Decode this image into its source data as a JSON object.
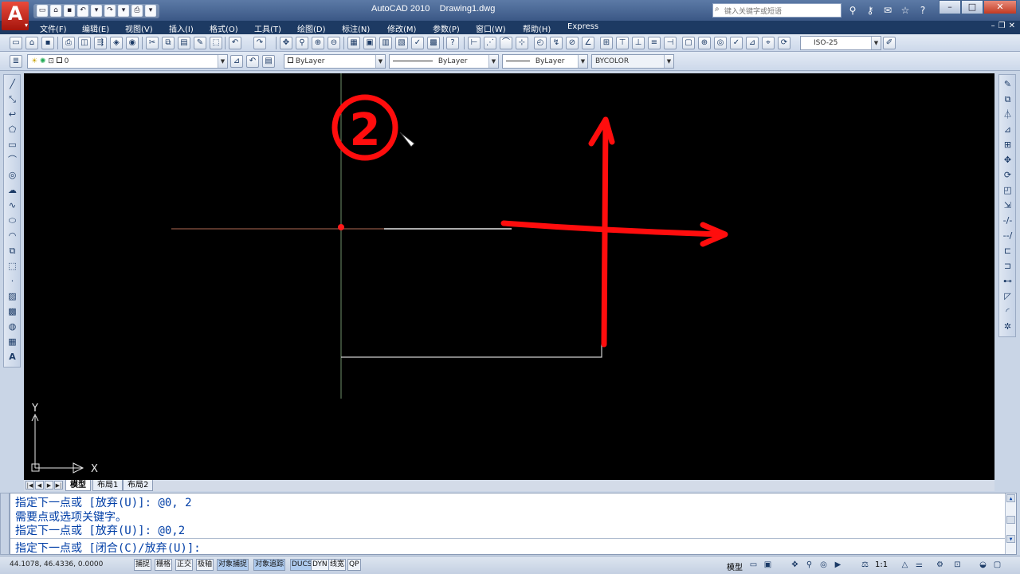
{
  "app": {
    "title": "AutoCAD 2010",
    "document": "Drawing1.dwg",
    "logo_letter": "A",
    "search_placeholder": "键入关键字或短语"
  },
  "menus": [
    "文件(F)",
    "编辑(E)",
    "视图(V)",
    "插入(I)",
    "格式(O)",
    "工具(T)",
    "绘图(D)",
    "标注(N)",
    "修改(M)",
    "参数(P)",
    "窗口(W)",
    "帮助(H)",
    "Express"
  ],
  "toolbar": {
    "dimstyle": "ISO-25",
    "layer": "0",
    "color": "ByLayer",
    "linetype": "ByLayer",
    "lineweight": "ByLayer",
    "plotstyle": "BYCOLOR"
  },
  "canvas": {
    "ucs_y": "Y",
    "ucs_x": "X",
    "annotation_number": "2"
  },
  "layout_tabs": [
    {
      "label": "模型",
      "active": true
    },
    {
      "label": "布局1",
      "active": false
    },
    {
      "label": "布局2",
      "active": false
    }
  ],
  "command": {
    "history": [
      "指定下一点或 [放弃(U)]: @0, 2",
      "需要点或选项关键字。",
      "指定下一点或 [放弃(U)]: @0,2"
    ],
    "prompt": "指定下一点或 [闭合(C)/放弃(U)]:"
  },
  "status": {
    "coords": "44.1078, 46.4336, 0.0000",
    "toggles": [
      {
        "label": "捕捉",
        "on": false
      },
      {
        "label": "栅格",
        "on": false
      },
      {
        "label": "正交",
        "on": false
      },
      {
        "label": "极轴",
        "on": false
      },
      {
        "label": "对象捕捉",
        "on": true
      },
      {
        "label": "对象追踪",
        "on": true
      },
      {
        "label": "DUCS",
        "on": true
      },
      {
        "label": "DYN",
        "on": false
      },
      {
        "label": "线宽",
        "on": false
      },
      {
        "label": "QP",
        "on": false
      }
    ],
    "model": "模型",
    "scale": "1:1"
  }
}
